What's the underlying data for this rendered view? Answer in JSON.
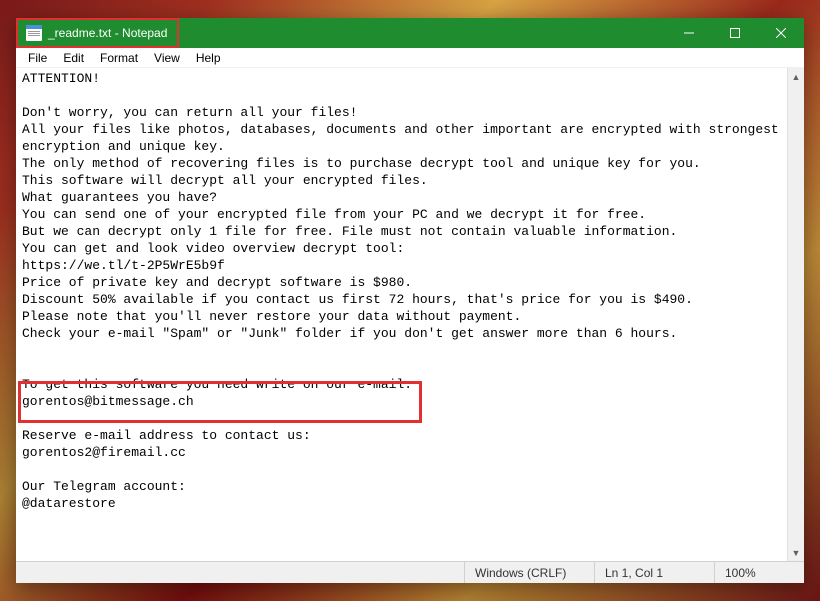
{
  "window": {
    "title": "_readme.txt - Notepad"
  },
  "menu": {
    "file": "File",
    "edit": "Edit",
    "format": "Format",
    "view": "View",
    "help": "Help"
  },
  "content": {
    "text": "ATTENTION!\n\nDon't worry, you can return all your files!\nAll your files like photos, databases, documents and other important are encrypted with strongest encryption and unique key.\nThe only method of recovering files is to purchase decrypt tool and unique key for you.\nThis software will decrypt all your encrypted files.\nWhat guarantees you have?\nYou can send one of your encrypted file from your PC and we decrypt it for free.\nBut we can decrypt only 1 file for free. File must not contain valuable information.\nYou can get and look video overview decrypt tool:\nhttps://we.tl/t-2P5WrE5b9f\nPrice of private key and decrypt software is $980.\nDiscount 50% available if you contact us first 72 hours, that's price for you is $490.\nPlease note that you'll never restore your data without payment.\nCheck your e-mail \"Spam\" or \"Junk\" folder if you don't get answer more than 6 hours.\n\n\nTo get this software you need write on our e-mail:\ngorentos@bitmessage.ch\n\nReserve e-mail address to contact us:\ngorentos2@firemail.cc\n\nOur Telegram account:\n@datarestore"
  },
  "status": {
    "encoding": "Windows (CRLF)",
    "position": "Ln 1, Col 1",
    "zoom": "100%"
  }
}
